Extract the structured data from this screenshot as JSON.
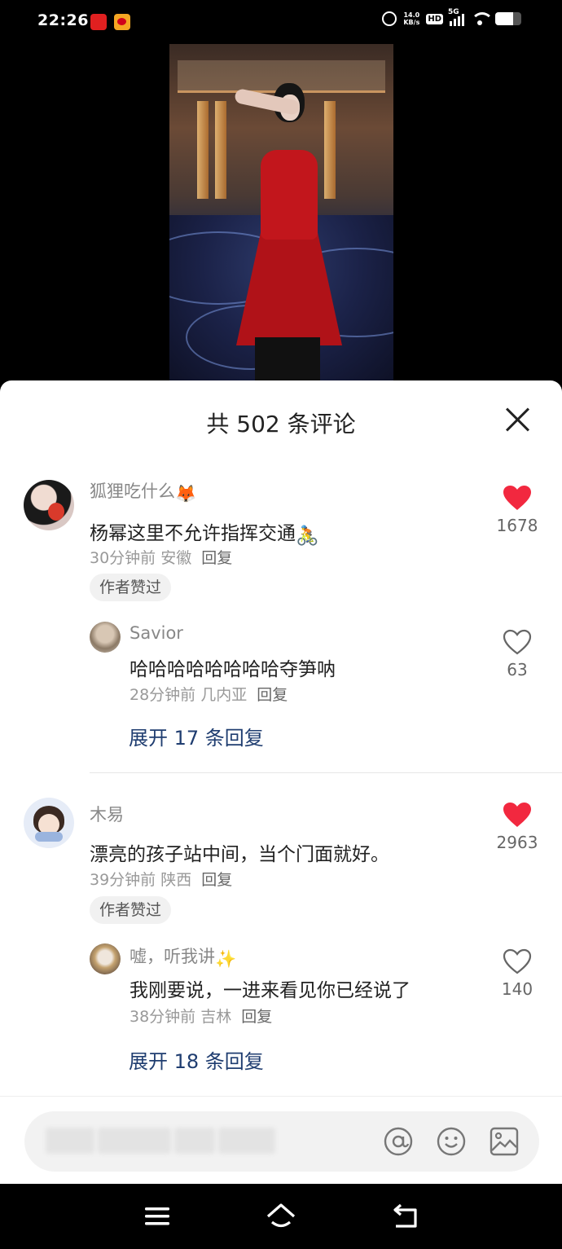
{
  "status_bar": {
    "time": "22:26",
    "net_speed_value": "14.0",
    "net_speed_unit": "KB/s",
    "hd": "HD",
    "network": "5G",
    "battery_level": 0.68,
    "icons": [
      "news-app-icon",
      "weibo-icon",
      "alarm-icon",
      "signal-icon",
      "wifi-icon",
      "battery-icon"
    ]
  },
  "panel": {
    "title": "共 502 条评论"
  },
  "comments": [
    {
      "user": "狐狸吃什么",
      "user_emoji": "🦊",
      "text": "杨幂这里不允许指挥交通",
      "text_emoji": "🚴",
      "time": "30分钟前",
      "location": "安徽",
      "reply_label": "回复",
      "badge": "作者赞过",
      "likes": "1678",
      "liked": true,
      "reply": {
        "user": "Savior",
        "text": "哈哈哈哈哈哈哈哈夺笋呐",
        "time": "28分钟前",
        "location": "几内亚",
        "reply_label": "回复",
        "likes": "63",
        "liked": false
      },
      "expand": "展开 17 条回复"
    },
    {
      "user": "木易",
      "text": "漂亮的孩子站中间，当个门面就好。",
      "time": "39分钟前",
      "location": "陕西",
      "reply_label": "回复",
      "badge": "作者赞过",
      "likes": "2963",
      "liked": true,
      "reply": {
        "user": "嘘，听我讲",
        "user_emoji": "✨",
        "text": "我刚要说，一进来看见你已经说了",
        "time": "38分钟前",
        "location": "吉林",
        "reply_label": "回复",
        "likes": "140",
        "liked": false
      },
      "expand": "展开 18 条回复"
    }
  ],
  "input_bar": {
    "placeholder": "",
    "icons": [
      "at-icon",
      "emoji-icon",
      "image-icon"
    ]
  },
  "colors": {
    "like_red": "#f2283f",
    "link_blue": "#1f3d70",
    "muted": "#999999"
  },
  "nav_bar": {
    "icons": [
      "menu-icon",
      "home-icon",
      "back-icon"
    ]
  }
}
